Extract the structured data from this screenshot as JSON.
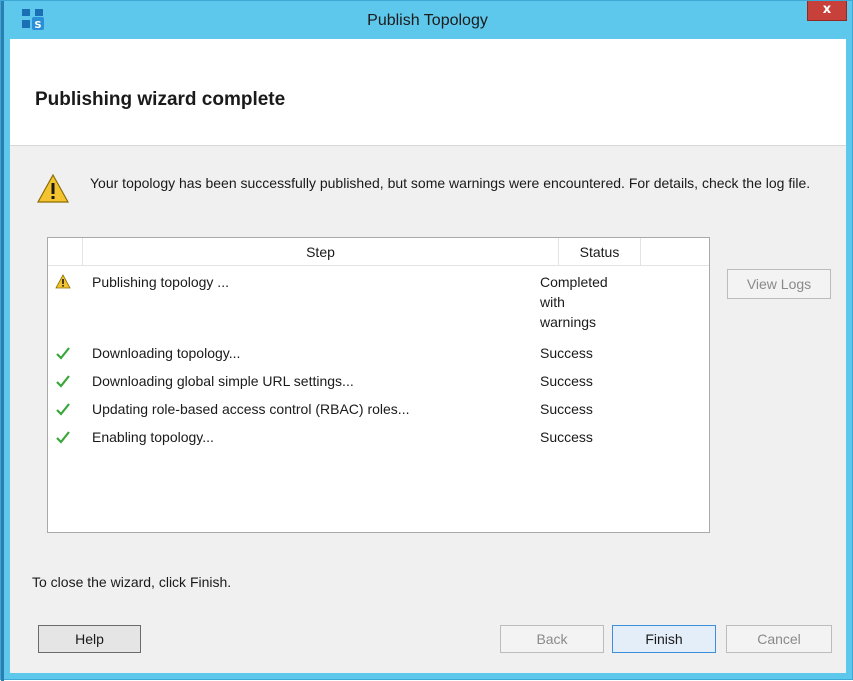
{
  "window": {
    "title": "Publish Topology",
    "close_label": "x",
    "colors": {
      "titlebar": "#5ec8ec",
      "close": "#c7413a"
    },
    "app_icon": "lync-topology-icon"
  },
  "header": {
    "title": "Publishing wizard complete"
  },
  "message": {
    "icon": "warning-icon",
    "text": "Your topology has been successfully published, but some warnings were encountered. For details, check the log file."
  },
  "list": {
    "columns": [
      "Step",
      "Status"
    ],
    "rows": [
      {
        "icon": "warning-icon",
        "step": "Publishing topology ...",
        "status_lines": [
          "Completed",
          "with",
          "warnings"
        ]
      },
      {
        "icon": "checkmark-icon",
        "step": "Downloading topology...",
        "status_lines": [
          "Success"
        ]
      },
      {
        "icon": "checkmark-icon",
        "step": "Downloading global simple URL settings...",
        "status_lines": [
          "Success"
        ]
      },
      {
        "icon": "checkmark-icon",
        "step": "Updating role-based access control (RBAC) roles...",
        "status_lines": [
          "Success"
        ]
      },
      {
        "icon": "checkmark-icon",
        "step": "Enabling topology...",
        "status_lines": [
          "Success"
        ]
      }
    ]
  },
  "side_button": {
    "label": "View Logs"
  },
  "footer": {
    "instruction": "To close the wizard, click Finish.",
    "help_label": "Help",
    "back_label": "Back",
    "finish_label": "Finish",
    "cancel_label": "Cancel"
  }
}
